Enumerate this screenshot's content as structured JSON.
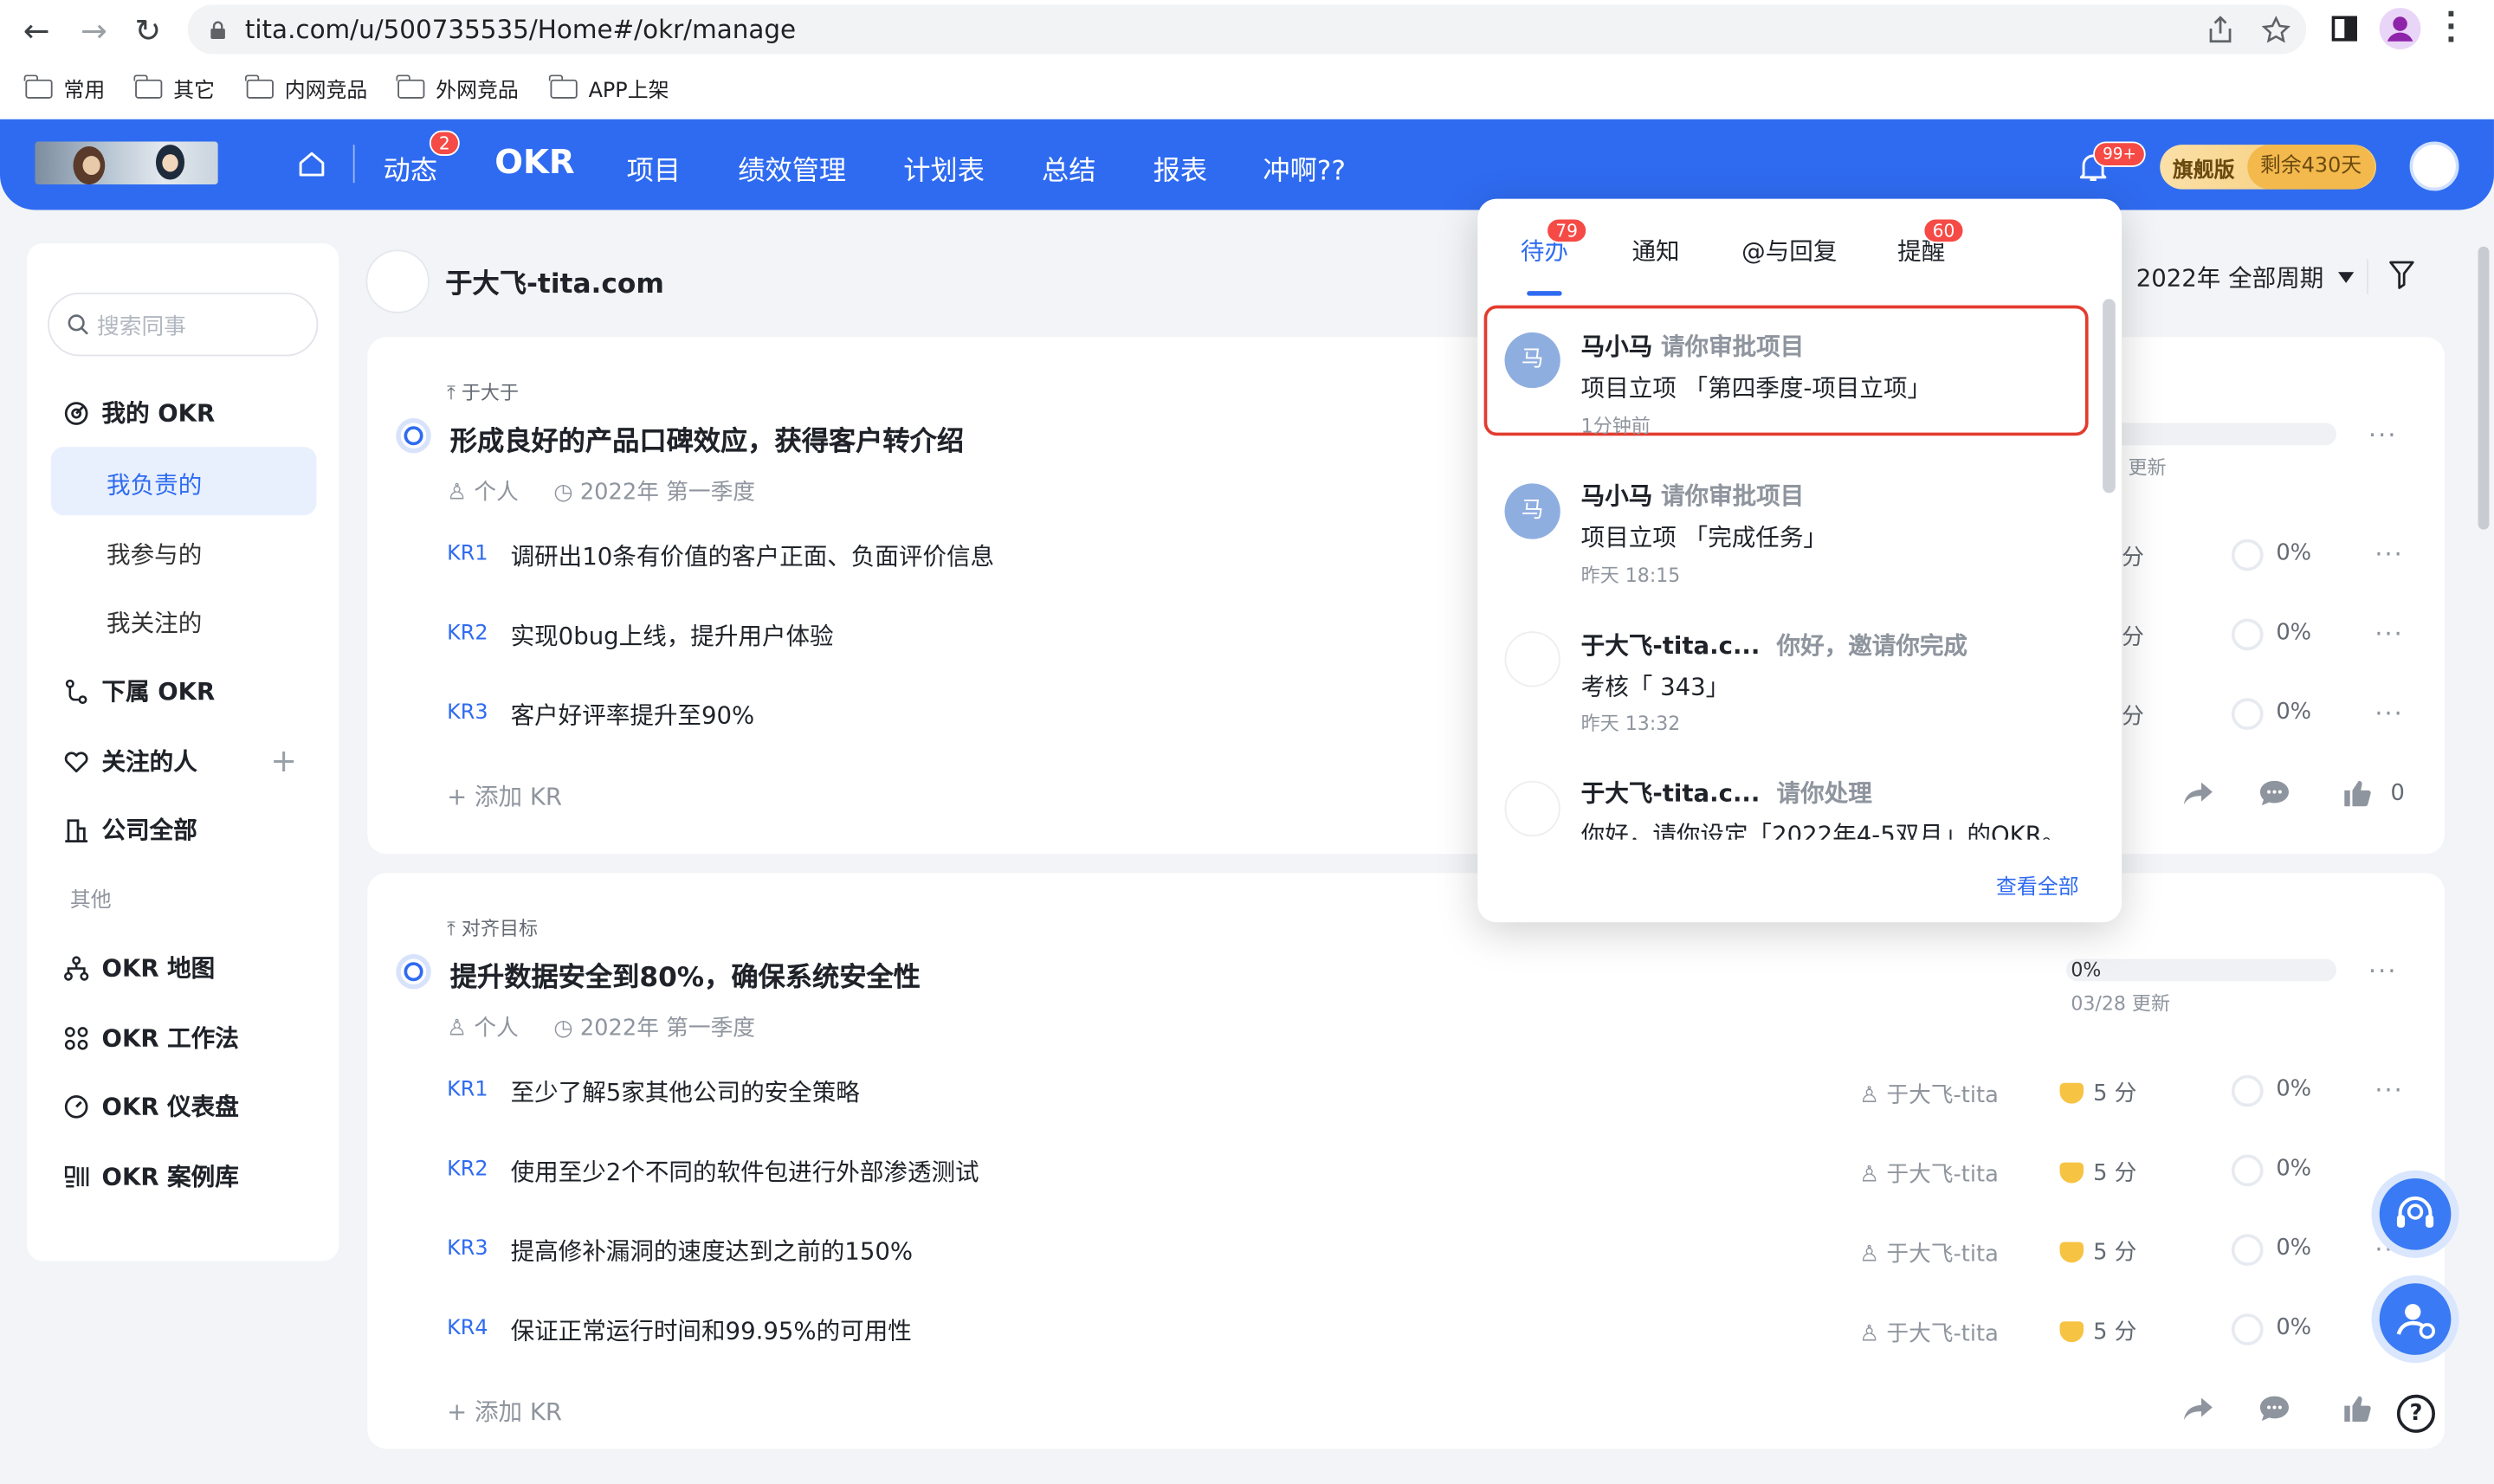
{
  "browser": {
    "url": "tita.com/u/500735535/Home#/okr/manage",
    "bookmarks": [
      "常用",
      "其它",
      "内网竞品",
      "外网竞品",
      "APP上架"
    ]
  },
  "header": {
    "nav": [
      "动态",
      "OKR",
      "项目",
      "绩效管理",
      "计划表",
      "总结",
      "报表",
      "冲啊??"
    ],
    "active_nav": "OKR",
    "dynamic_badge": "2",
    "bell_badge": "99+",
    "vip_label": "旗舰版",
    "vip_remaining": "剩余430天"
  },
  "sidebar": {
    "search_placeholder": "搜索同事",
    "my_okr": "我的 OKR",
    "my_okr_items": [
      "我负责的",
      "我参与的",
      "我关注的"
    ],
    "sub_okr": "下属 OKR",
    "followed": "关注的人",
    "company": "公司全部",
    "other_caption": "其他",
    "others": [
      "OKR 地图",
      "OKR 工作法",
      "OKR 仪表盘",
      "OKR 案例库"
    ]
  },
  "main": {
    "owner": "于大飞-tita.com",
    "period": "2022年 全部周期",
    "objectives": [
      {
        "parent": "于大于",
        "title": "形成良好的产品口碑效应，获得客户转介绍",
        "type": "个人",
        "cycle": "2022年 第一季度",
        "update": "更新",
        "krs": [
          {
            "tag": "KR1",
            "text": "调研出10条有价值的客户正面、负面评价信息",
            "score": "分",
            "progress": "0%"
          },
          {
            "tag": "KR2",
            "text": "实现0bug上线，提升用户体验",
            "score": "分",
            "progress": "0%"
          },
          {
            "tag": "KR3",
            "text": "客户好评率提升至90%",
            "score": "分",
            "progress": "0%"
          }
        ],
        "add_kr": "添加 KR",
        "likes": "0"
      },
      {
        "parent": "对齐目标",
        "title": "提升数据安全到80%，确保系统安全性",
        "type": "个人",
        "cycle": "2022年 第一季度",
        "progress": "0%",
        "update": "03/28 更新",
        "krs": [
          {
            "tag": "KR1",
            "text": "至少了解5家其他公司的安全策略",
            "owner": "于大飞-tita",
            "score": "5 分",
            "progress": "0%"
          },
          {
            "tag": "KR2",
            "text": "使用至少2个不同的软件包进行外部渗透测试",
            "owner": "于大飞-tita",
            "score": "5 分",
            "progress": "0%"
          },
          {
            "tag": "KR3",
            "text": "提高修补漏洞的速度达到之前的150%",
            "owner": "于大飞-tita",
            "score": "5 分",
            "progress": "0%"
          },
          {
            "tag": "KR4",
            "text": "保证正常运行时间和99.95%的可用性",
            "owner": "于大飞-tita",
            "score": "5 分",
            "progress": "0%"
          }
        ],
        "add_kr": "添加 KR"
      }
    ]
  },
  "popup": {
    "tabs": [
      "待办",
      "通知",
      "@与回复",
      "提醒"
    ],
    "todo_badge": "79",
    "remind_badge": "60",
    "items": [
      {
        "avatar": "马",
        "name": "马小马",
        "action": "请你审批项目",
        "body": "项目立项 「第四季度-项目立项」",
        "time": "1分钟前"
      },
      {
        "avatar": "马",
        "name": "马小马",
        "action": "请你审批项目",
        "body": "项目立项 「完成任务」",
        "time": "昨天 18:15"
      },
      {
        "name": "于大飞-tita.c...",
        "action": "你好，邀请你完成",
        "body": "考核「 343」",
        "time": "昨天 13:32"
      },
      {
        "name": "于大飞-tita.c...",
        "action": "请你处理",
        "body": "你好，请你设定「2022年4-5双月」的OKR。"
      }
    ],
    "view_all": "查看全部"
  }
}
